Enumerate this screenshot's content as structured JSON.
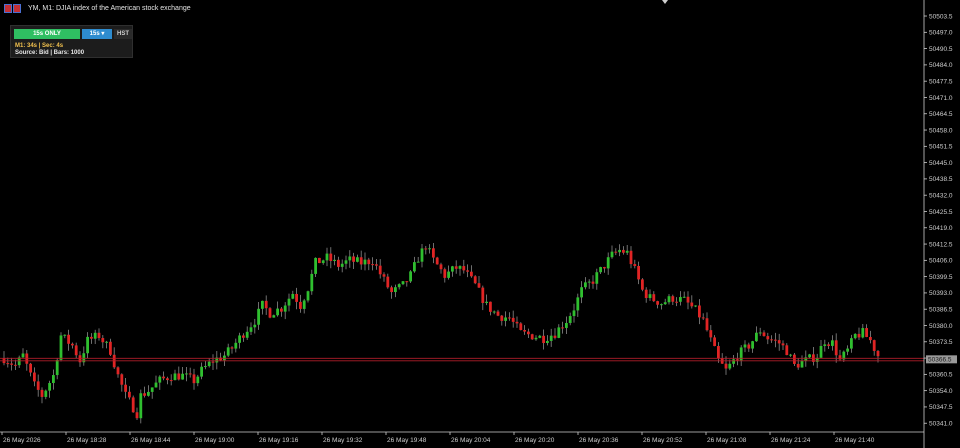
{
  "header": {
    "title": "YM, M1:  DJIA index of the American stock exchange"
  },
  "panel": {
    "btn_mode": "15s ONLY",
    "btn_tf": "15s ▾",
    "btn_hst": "HST",
    "info_line1": "M1: 34s | Sec: 4s",
    "info_line2": "Source: Bid | Bars: 1000"
  },
  "colors": {
    "bull": "#2fbf2f",
    "bear": "#e02424",
    "wick": "#8a8a8a",
    "price_line": "#b11e2a",
    "axis_line": "#cfcfcf",
    "price_label_bg": "#9a9a9a"
  },
  "chart_data": {
    "type": "candlestick",
    "instrument": "YM",
    "timeframe": "M1",
    "current_price_label": "50366.5",
    "current_price": 50366.5,
    "ylim": [
      50337.5,
      50507.5
    ],
    "y_ticks": [
      "50503.5",
      "50497.0",
      "50490.5",
      "50484.0",
      "50477.5",
      "50471.0",
      "50464.5",
      "50458.0",
      "50451.5",
      "50445.0",
      "50438.5",
      "50432.0",
      "50425.5",
      "50419.0",
      "50412.5",
      "50406.0",
      "50399.5",
      "50393.0",
      "50386.5",
      "50380.0",
      "50373.5",
      "50367.0",
      "50360.5",
      "50354.0",
      "50347.5",
      "50341.0"
    ],
    "x_ticks": [
      "26 May 2026",
      "26 May 18:28",
      "26 May 18:44",
      "26 May 19:00",
      "26 May 19:16",
      "26 May 19:32",
      "26 May 19:48",
      "26 May 20:04",
      "26 May 20:20",
      "26 May 20:36",
      "26 May 20:52",
      "26 May 21:08",
      "26 May 21:24",
      "26 May 21:40"
    ],
    "close_path": [
      [
        0,
        50367
      ],
      [
        3,
        50364
      ],
      [
        5,
        50368
      ],
      [
        8,
        50356
      ],
      [
        10,
        50352
      ],
      [
        13,
        50360
      ],
      [
        15,
        50376
      ],
      [
        18,
        50372
      ],
      [
        20,
        50366
      ],
      [
        22,
        50374
      ],
      [
        25,
        50376
      ],
      [
        28,
        50370
      ],
      [
        30,
        50360
      ],
      [
        32,
        50352
      ],
      [
        35,
        50345
      ],
      [
        36,
        50352
      ],
      [
        38,
        50354
      ],
      [
        41,
        50358
      ],
      [
        44,
        50360
      ],
      [
        47,
        50360
      ],
      [
        50,
        50358
      ],
      [
        52,
        50362
      ],
      [
        55,
        50366
      ],
      [
        58,
        50368
      ],
      [
        60,
        50371
      ],
      [
        63,
        50377
      ],
      [
        66,
        50382
      ],
      [
        68,
        50388
      ],
      [
        70,
        50385
      ],
      [
        73,
        50387
      ],
      [
        76,
        50393
      ],
      [
        78,
        50388
      ],
      [
        80,
        50395
      ],
      [
        82,
        50405
      ],
      [
        85,
        50407
      ],
      [
        88,
        50404
      ],
      [
        91,
        50406
      ],
      [
        94,
        50405
      ],
      [
        97,
        50406
      ],
      [
        100,
        50398
      ],
      [
        102,
        50393
      ],
      [
        105,
        50396
      ],
      [
        107,
        50400
      ],
      [
        109,
        50407
      ],
      [
        111,
        50412
      ],
      [
        113,
        50406
      ],
      [
        116,
        50400
      ],
      [
        119,
        50403
      ],
      [
        121,
        50402
      ],
      [
        124,
        50396
      ],
      [
        127,
        50388
      ],
      [
        130,
        50384
      ],
      [
        133,
        50383
      ],
      [
        136,
        50377
      ],
      [
        139,
        50376
      ],
      [
        142,
        50375
      ],
      [
        145,
        50377
      ],
      [
        148,
        50382
      ],
      [
        150,
        50387
      ],
      [
        152,
        50394
      ],
      [
        155,
        50398
      ],
      [
        158,
        50404
      ],
      [
        160,
        50408
      ],
      [
        162,
        50410
      ],
      [
        164,
        50409
      ],
      [
        166,
        50402
      ],
      [
        168,
        50394
      ],
      [
        170,
        50391
      ],
      [
        173,
        50389
      ],
      [
        176,
        50391
      ],
      [
        179,
        50390
      ],
      [
        182,
        50386
      ],
      [
        184,
        50382
      ],
      [
        186,
        50374
      ],
      [
        188,
        50366
      ],
      [
        190,
        50362
      ],
      [
        193,
        50368
      ],
      [
        196,
        50372
      ],
      [
        199,
        50378
      ],
      [
        201,
        50375
      ],
      [
        204,
        50373
      ],
      [
        206,
        50370
      ],
      [
        208,
        50364
      ],
      [
        211,
        50366
      ],
      [
        214,
        50368
      ],
      [
        216,
        50374
      ],
      [
        218,
        50373
      ],
      [
        220,
        50366
      ],
      [
        222,
        50370
      ],
      [
        224,
        50376
      ],
      [
        226,
        50377
      ],
      [
        228,
        50374
      ],
      [
        230,
        50368
      ]
    ]
  }
}
